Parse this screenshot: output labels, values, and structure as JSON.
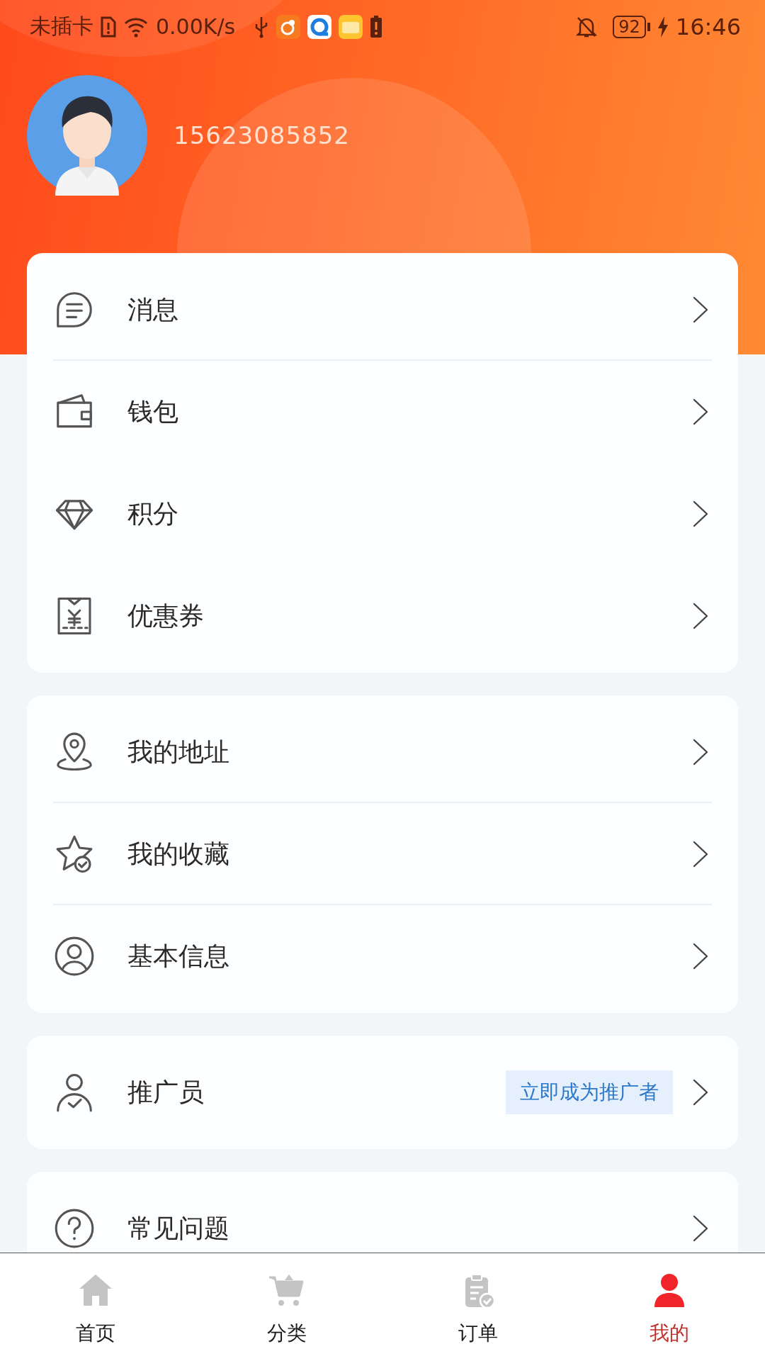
{
  "status_bar": {
    "carrier": "未插卡",
    "network_speed": "0.00K/s",
    "battery": "92",
    "time": "16:46"
  },
  "profile": {
    "phone": "15623085852"
  },
  "menu_groups": [
    {
      "items": [
        {
          "label": "消息"
        },
        {
          "label": "钱包"
        },
        {
          "label": "积分"
        },
        {
          "label": "优惠券"
        }
      ]
    },
    {
      "items": [
        {
          "label": "我的地址"
        },
        {
          "label": "我的收藏"
        },
        {
          "label": "基本信息"
        }
      ]
    },
    {
      "items": [
        {
          "label": "推广员",
          "tag": "立即成为推广者"
        }
      ]
    },
    {
      "items": [
        {
          "label": "常见问题"
        }
      ]
    }
  ],
  "bottom_nav": [
    {
      "label": "首页",
      "selected": false
    },
    {
      "label": "分类",
      "selected": false
    },
    {
      "label": "订单",
      "selected": false
    },
    {
      "label": "我的",
      "selected": true
    }
  ]
}
